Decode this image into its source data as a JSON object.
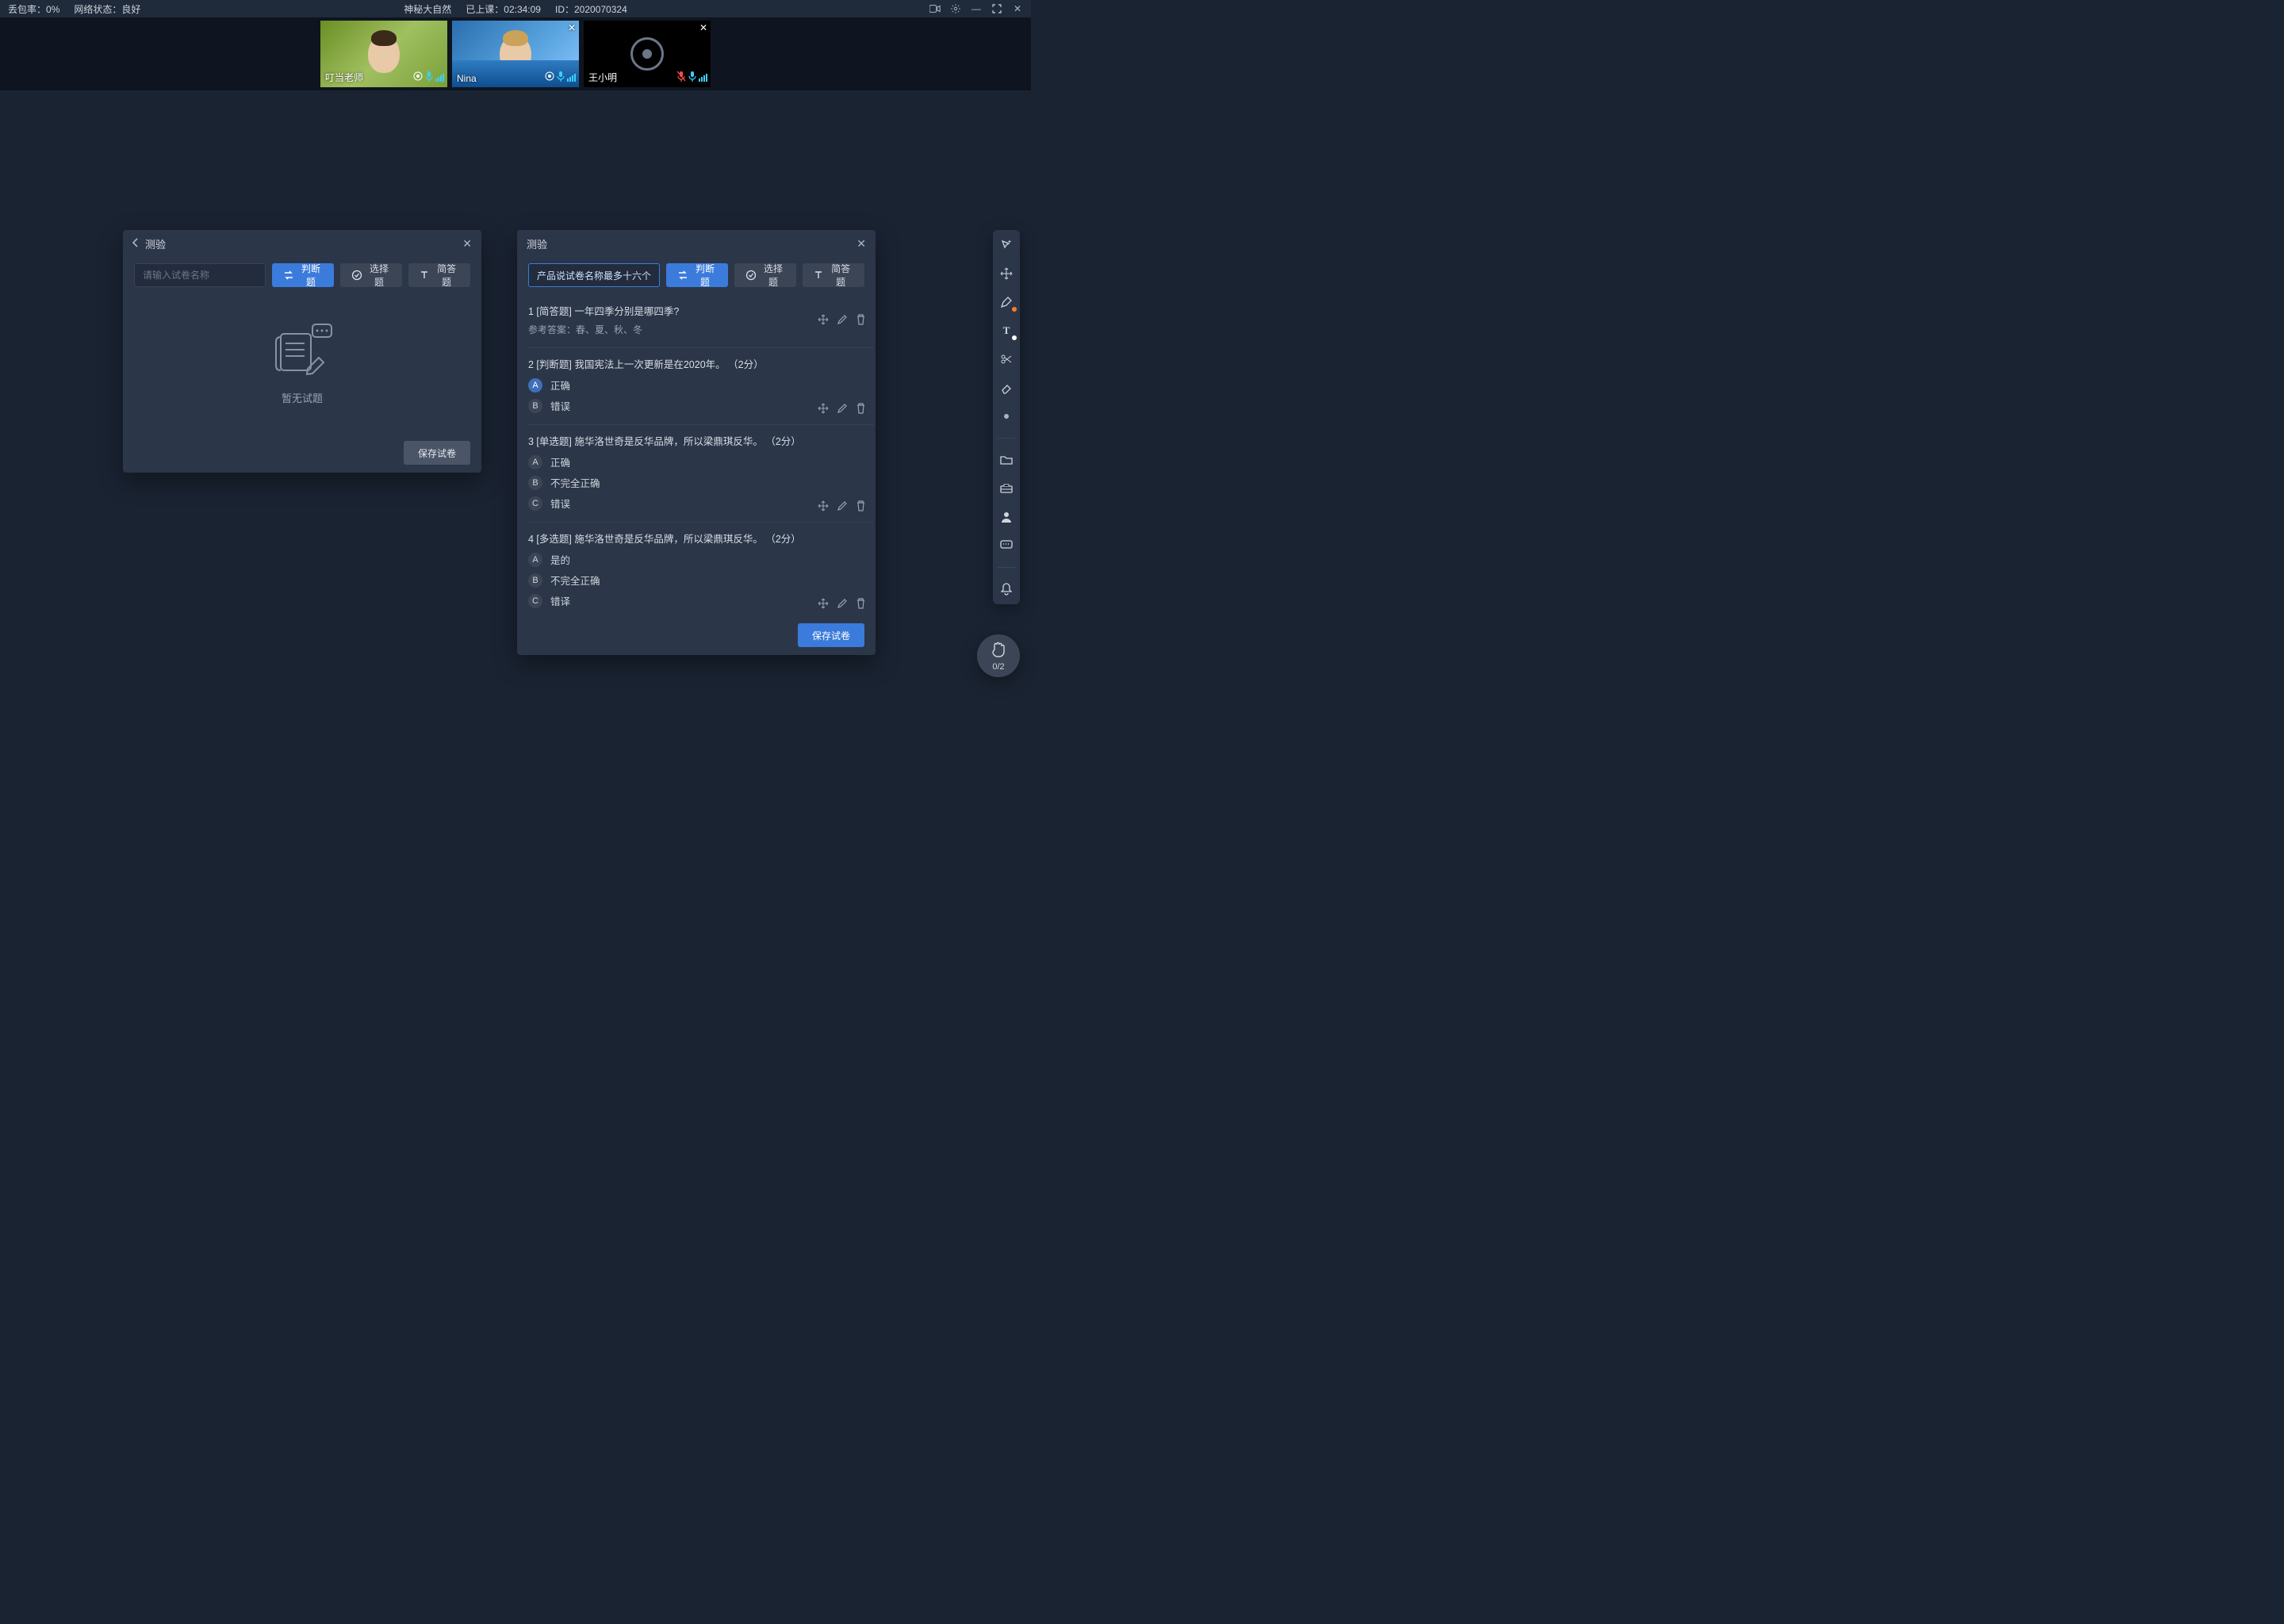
{
  "topbar": {
    "loss_label": "丢包率：",
    "loss_value": "0%",
    "net_label": "网络状态：",
    "net_value": "良好",
    "course_title": "神秘大自然",
    "elapsed_label": "已上课：",
    "elapsed_value": "02:34:09",
    "id_label": "ID：",
    "id_value": "2020070324"
  },
  "videos": [
    {
      "name": "叮当老师",
      "has_close": false,
      "cam_off": false,
      "portrait": "a",
      "mic": "on"
    },
    {
      "name": "Nina",
      "has_close": true,
      "cam_off": false,
      "portrait": "b",
      "mic": "on"
    },
    {
      "name": "王小明",
      "has_close": true,
      "cam_off": true,
      "portrait": "c",
      "mic": "muted"
    }
  ],
  "panelLeft": {
    "title": "测验",
    "input_placeholder": "请输入试卷名称",
    "btn_tf": "判断题",
    "btn_choice": "选择题",
    "btn_short": "简答题",
    "empty_text": "暂无试题",
    "save": "保存试卷"
  },
  "panelRight": {
    "title": "测验",
    "input_value": "产品说试卷名称最多十六个字",
    "btn_tf": "判断题",
    "btn_choice": "选择题",
    "btn_short": "简答题",
    "save": "保存试卷",
    "answer_prefix": "参考答案：",
    "questions": [
      {
        "idx": "1",
        "tag": "[简答题]",
        "text": "一年四季分别是哪四季?",
        "answer": "春、夏、秋、冬",
        "actions_top": true
      },
      {
        "idx": "2",
        "tag": "[判断题]",
        "text": "我国宪法上一次更新是在2020年。",
        "pts": "（2分）",
        "options": [
          {
            "letter": "A",
            "label": "正确",
            "selected": true
          },
          {
            "letter": "B",
            "label": "错误",
            "selected": false
          }
        ]
      },
      {
        "idx": "3",
        "tag": "[单选题]",
        "text": "施华洛世奇是反华品牌，所以梁鼎琪反华。",
        "pts": "（2分）",
        "options": [
          {
            "letter": "A",
            "label": "正确",
            "selected": false
          },
          {
            "letter": "B",
            "label": "不完全正确",
            "selected": false
          },
          {
            "letter": "C",
            "label": "错误",
            "selected": false
          }
        ]
      },
      {
        "idx": "4",
        "tag": "[多选题]",
        "text": "施华洛世奇是反华品牌，所以梁鼎琪反华。",
        "pts": "（2分）",
        "options": [
          {
            "letter": "A",
            "label": "是的",
            "selected": false
          },
          {
            "letter": "B",
            "label": "不完全正确",
            "selected": false
          },
          {
            "letter": "C",
            "label": "错译",
            "selected": false
          }
        ]
      }
    ]
  },
  "hand": {
    "count": "0/2"
  },
  "colors": {
    "accent": "#3b7bdc",
    "orange": "#ff7a2d",
    "cyan": "#3ad1ff",
    "red": "#ff4d4d"
  }
}
